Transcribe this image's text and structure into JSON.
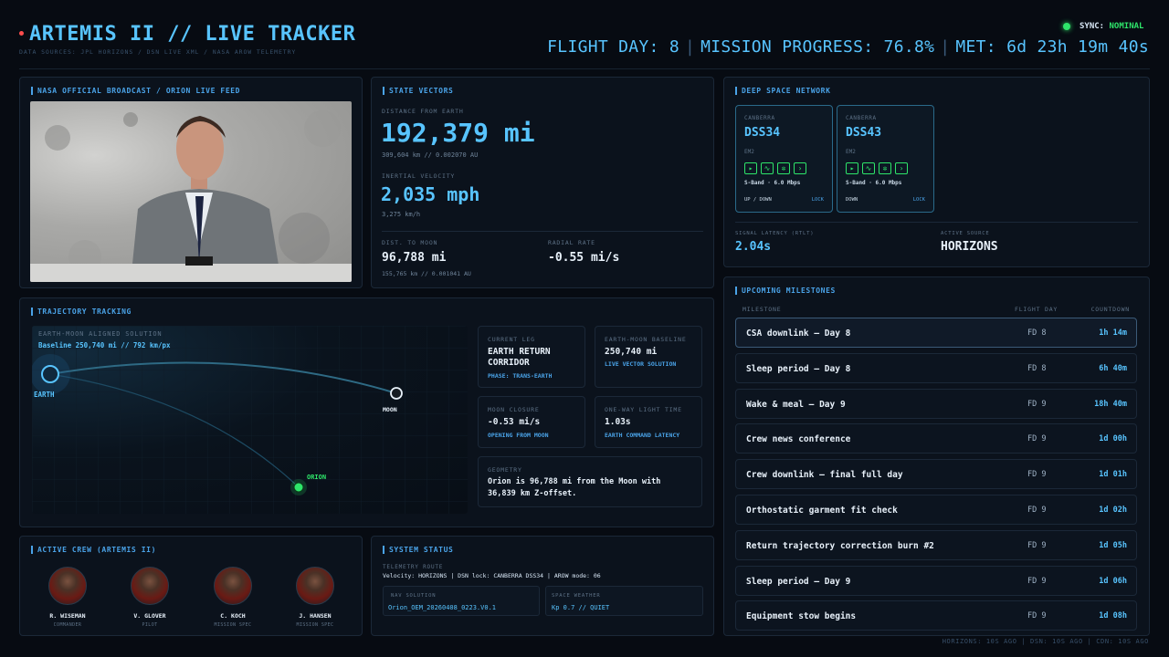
{
  "header": {
    "title": "ARTEMIS II // LIVE TRACKER",
    "sources": "DATA SOURCES: JPL HORIZONS / DSN LIVE XML / NASA AROW TELEMETRY",
    "sync_label": "SYNC:",
    "sync_value": "NOMINAL",
    "flight_day": "FLIGHT DAY: 8",
    "mission_progress": "MISSION PROGRESS: 76.8%",
    "met": "MET: 6d 23h 19m 40s",
    "separator": "|",
    "status_color": "#2ee56a",
    "accent_color": "#58c4ff"
  },
  "broadcast": {
    "title": "NASA OFFICIAL BROADCAST / ORION LIVE FEED"
  },
  "state_vectors": {
    "title": "STATE VECTORS",
    "distance_label": "DISTANCE FROM EARTH",
    "distance_value": "192,379 mi",
    "distance_sub": "309,604 km // 0.002070 AU",
    "velocity_label": "INERTIAL VELOCITY",
    "velocity_value": "2,035 mph",
    "velocity_sub": "3,275 km/h",
    "moon_label": "DIST. TO MOON",
    "moon_value": "96,788 mi",
    "moon_sub": "155,765 km // 0.001041 AU",
    "radial_label": "RADIAL RATE",
    "radial_value": "-0.55 mi/s"
  },
  "dsn": {
    "title": "DEEP SPACE NETWORK",
    "stations": [
      {
        "location": "CANBERRA",
        "name": "DSS34",
        "target": "EM2",
        "band": "S-Band · 6.0 Mbps",
        "direction": "UP / DOWN",
        "lock": "LOCK"
      },
      {
        "location": "CANBERRA",
        "name": "DSS43",
        "target": "EM2",
        "band": "S-Band · 6.0 Mbps",
        "direction": "DOWN",
        "lock": "LOCK"
      }
    ],
    "latency_label": "SIGNAL LATENCY (RTLT)",
    "latency_value": "2.04s",
    "source_label": "ACTIVE SOURCE",
    "source_value": "HORIZONS"
  },
  "trajectory": {
    "title": "TRAJECTORY TRACKING",
    "solution_label": "EARTH-MOON ALIGNED SOLUTION",
    "baseline_text": "Baseline 250,740 mi // 792 km/px",
    "earth_label": "EARTH",
    "moon_label": "MOON",
    "orion_label": "ORION",
    "cards": {
      "leg_label": "CURRENT LEG",
      "leg_value": "EARTH RETURN CORRIDOR",
      "leg_caption": "PHASE: TRANS-EARTH",
      "baseline_label": "EARTH-MOON BASELINE",
      "baseline_value": "250,740 mi",
      "baseline_caption": "LIVE VECTOR SOLUTION",
      "closure_label": "MOON CLOSURE",
      "closure_value": "-0.53 mi/s",
      "closure_caption": "OPENING FROM MOON",
      "light_label": "ONE-WAY LIGHT TIME",
      "light_value": "1.03s",
      "light_caption": "EARTH COMMAND LATENCY",
      "geometry_label": "GEOMETRY",
      "geometry_value": "Orion is 96,788 mi from the Moon with 36,839 km Z-offset."
    }
  },
  "milestones": {
    "title": "UPCOMING MILESTONES",
    "col_milestone": "MILESTONE",
    "col_day": "FLIGHT DAY",
    "col_countdown": "COUNTDOWN",
    "items": [
      {
        "name": "CSA downlink — Day 8",
        "day": "FD 8",
        "countdown": "1h 14m"
      },
      {
        "name": "Sleep period — Day 8",
        "day": "FD 8",
        "countdown": "6h 40m"
      },
      {
        "name": "Wake & meal — Day 9",
        "day": "FD 9",
        "countdown": "18h 40m"
      },
      {
        "name": "Crew news conference",
        "day": "FD 9",
        "countdown": "1d 00h"
      },
      {
        "name": "Crew downlink — final full day",
        "day": "FD 9",
        "countdown": "1d 01h"
      },
      {
        "name": "Orthostatic garment fit check",
        "day": "FD 9",
        "countdown": "1d 02h"
      },
      {
        "name": "Return trajectory correction burn #2",
        "day": "FD 9",
        "countdown": "1d 05h"
      },
      {
        "name": "Sleep period — Day 9",
        "day": "FD 9",
        "countdown": "1d 06h"
      },
      {
        "name": "Equipment stow begins",
        "day": "FD 9",
        "countdown": "1d 08h"
      }
    ]
  },
  "crew": {
    "title": "ACTIVE CREW (ARTEMIS II)",
    "members": [
      {
        "name": "R. WISEMAN",
        "role": "COMMANDER"
      },
      {
        "name": "V. GLOVER",
        "role": "PILOT"
      },
      {
        "name": "C. KOCH",
        "role": "MISSION SPEC"
      },
      {
        "name": "J. HANSEN",
        "role": "MISSION SPEC"
      }
    ]
  },
  "system": {
    "title": "SYSTEM STATUS",
    "route_label": "TELEMETRY ROUTE",
    "route_value": "Velocity: HORIZONS | DSN lock: CANBERRA DSS34 | AROW mode: 06",
    "nav_label": "NAV SOLUTION",
    "nav_value": "Orion_OEM_20260408_0223.V0.1",
    "weather_label": "SPACE WEATHER",
    "weather_value": "Kp 0.7 // QUIET"
  },
  "footer": {
    "text": "HORIZONS: 10S AGO | DSN: 10S AGO | CDN: 10S AGO"
  }
}
